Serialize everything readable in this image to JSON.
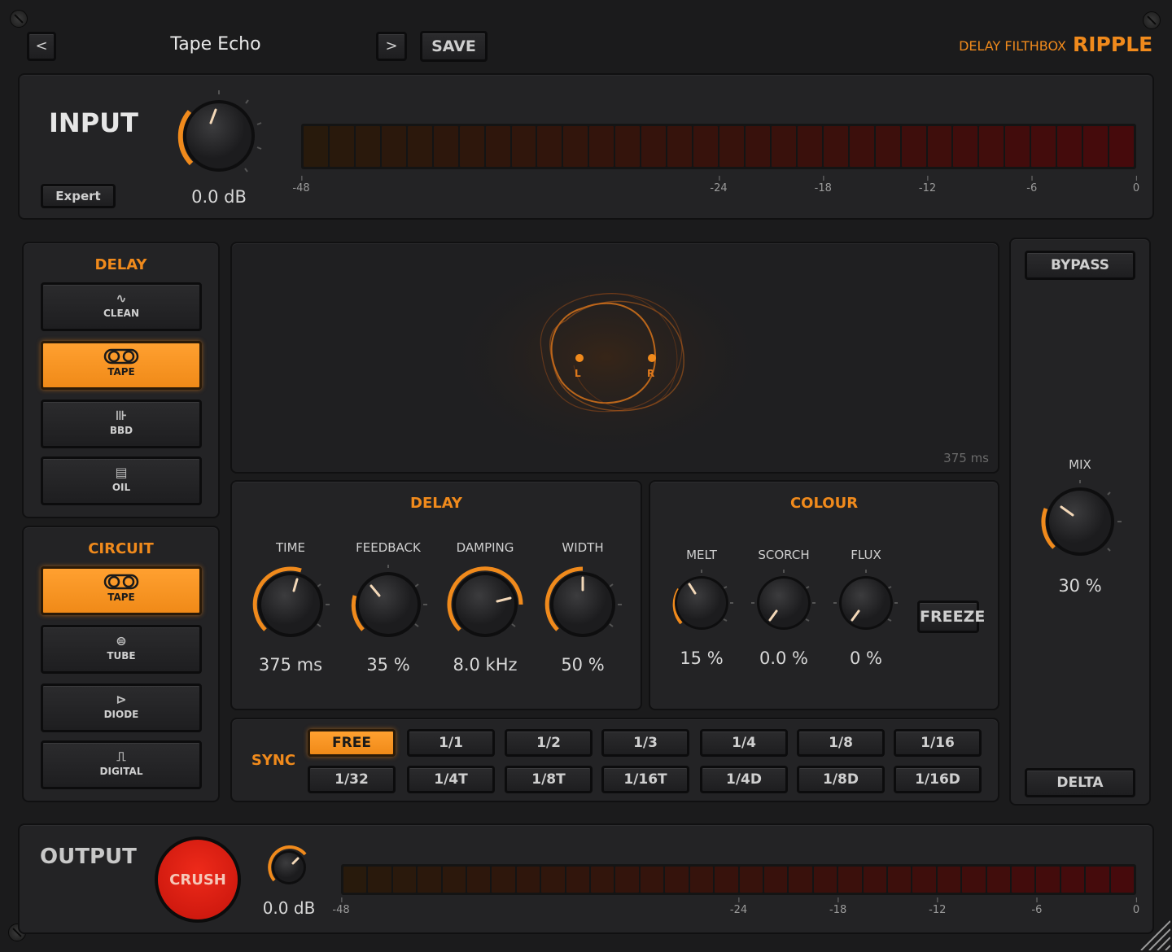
{
  "header": {
    "prev_label": "<",
    "preset_name": "Tape Echo",
    "next_label": ">",
    "save_label": "SAVE",
    "brand_label": "DELAY FILTHBOX",
    "product_name": "RIPPLE"
  },
  "input": {
    "title": "INPUT",
    "expert_label": "Expert",
    "gain_value": "0.0 dB",
    "scale": [
      "-48",
      "-24",
      "-18",
      "-12",
      "-6",
      "0"
    ]
  },
  "delay_modes": {
    "title": "DELAY",
    "items": [
      {
        "label": "CLEAN",
        "icon": "clean-wave-icon",
        "active": false
      },
      {
        "label": "TAPE",
        "icon": "tape-reel-icon",
        "active": true
      },
      {
        "label": "BBD",
        "icon": "chip-icon",
        "active": false
      },
      {
        "label": "OIL",
        "icon": "oil-can-icon",
        "active": false
      }
    ]
  },
  "circuit_modes": {
    "title": "CIRCUIT",
    "items": [
      {
        "label": "TAPE",
        "icon": "tape-reel-icon",
        "active": true
      },
      {
        "label": "TUBE",
        "icon": "tube-icon",
        "active": false
      },
      {
        "label": "DIODE",
        "icon": "diode-icon",
        "active": false
      },
      {
        "label": "DIGITAL",
        "icon": "digital-square-icon",
        "active": false
      }
    ]
  },
  "visualizer": {
    "left_label": "L",
    "right_label": "R",
    "time_readout": "375 ms"
  },
  "delay_section": {
    "title": "DELAY",
    "knobs": [
      {
        "label": "TIME",
        "value": "375 ms"
      },
      {
        "label": "FEEDBACK",
        "value": "35 %"
      },
      {
        "label": "DAMPING",
        "value": "8.0 kHz"
      },
      {
        "label": "WIDTH",
        "value": "50 %"
      }
    ]
  },
  "colour_section": {
    "title": "COLOUR",
    "knobs": [
      {
        "label": "MELT",
        "value": "15 %"
      },
      {
        "label": "SCORCH",
        "value": "0.0 %"
      },
      {
        "label": "FLUX",
        "value": "0 %"
      }
    ],
    "freeze_label": "FREEZE"
  },
  "sync": {
    "title": "SYNC",
    "row1": [
      "FREE",
      "1/1",
      "1/2",
      "1/3",
      "1/4",
      "1/8",
      "1/16"
    ],
    "row2": [
      "1/32",
      "1/4T",
      "1/8T",
      "1/16T",
      "1/4D",
      "1/8D",
      "1/16D"
    ],
    "selected": "FREE"
  },
  "right_panel": {
    "bypass_label": "BYPASS",
    "mix_label": "MIX",
    "mix_value": "30 %",
    "delta_label": "DELTA"
  },
  "output": {
    "title": "OUTPUT",
    "crush_label": "CRUSH",
    "gain_value": "0.0 dB",
    "scale": [
      "-48",
      "-24",
      "-18",
      "-12",
      "-6",
      "0"
    ]
  },
  "colors": {
    "accent": "#f08a1c",
    "crush_red": "#d8180f",
    "background": "#1b1b1c"
  }
}
